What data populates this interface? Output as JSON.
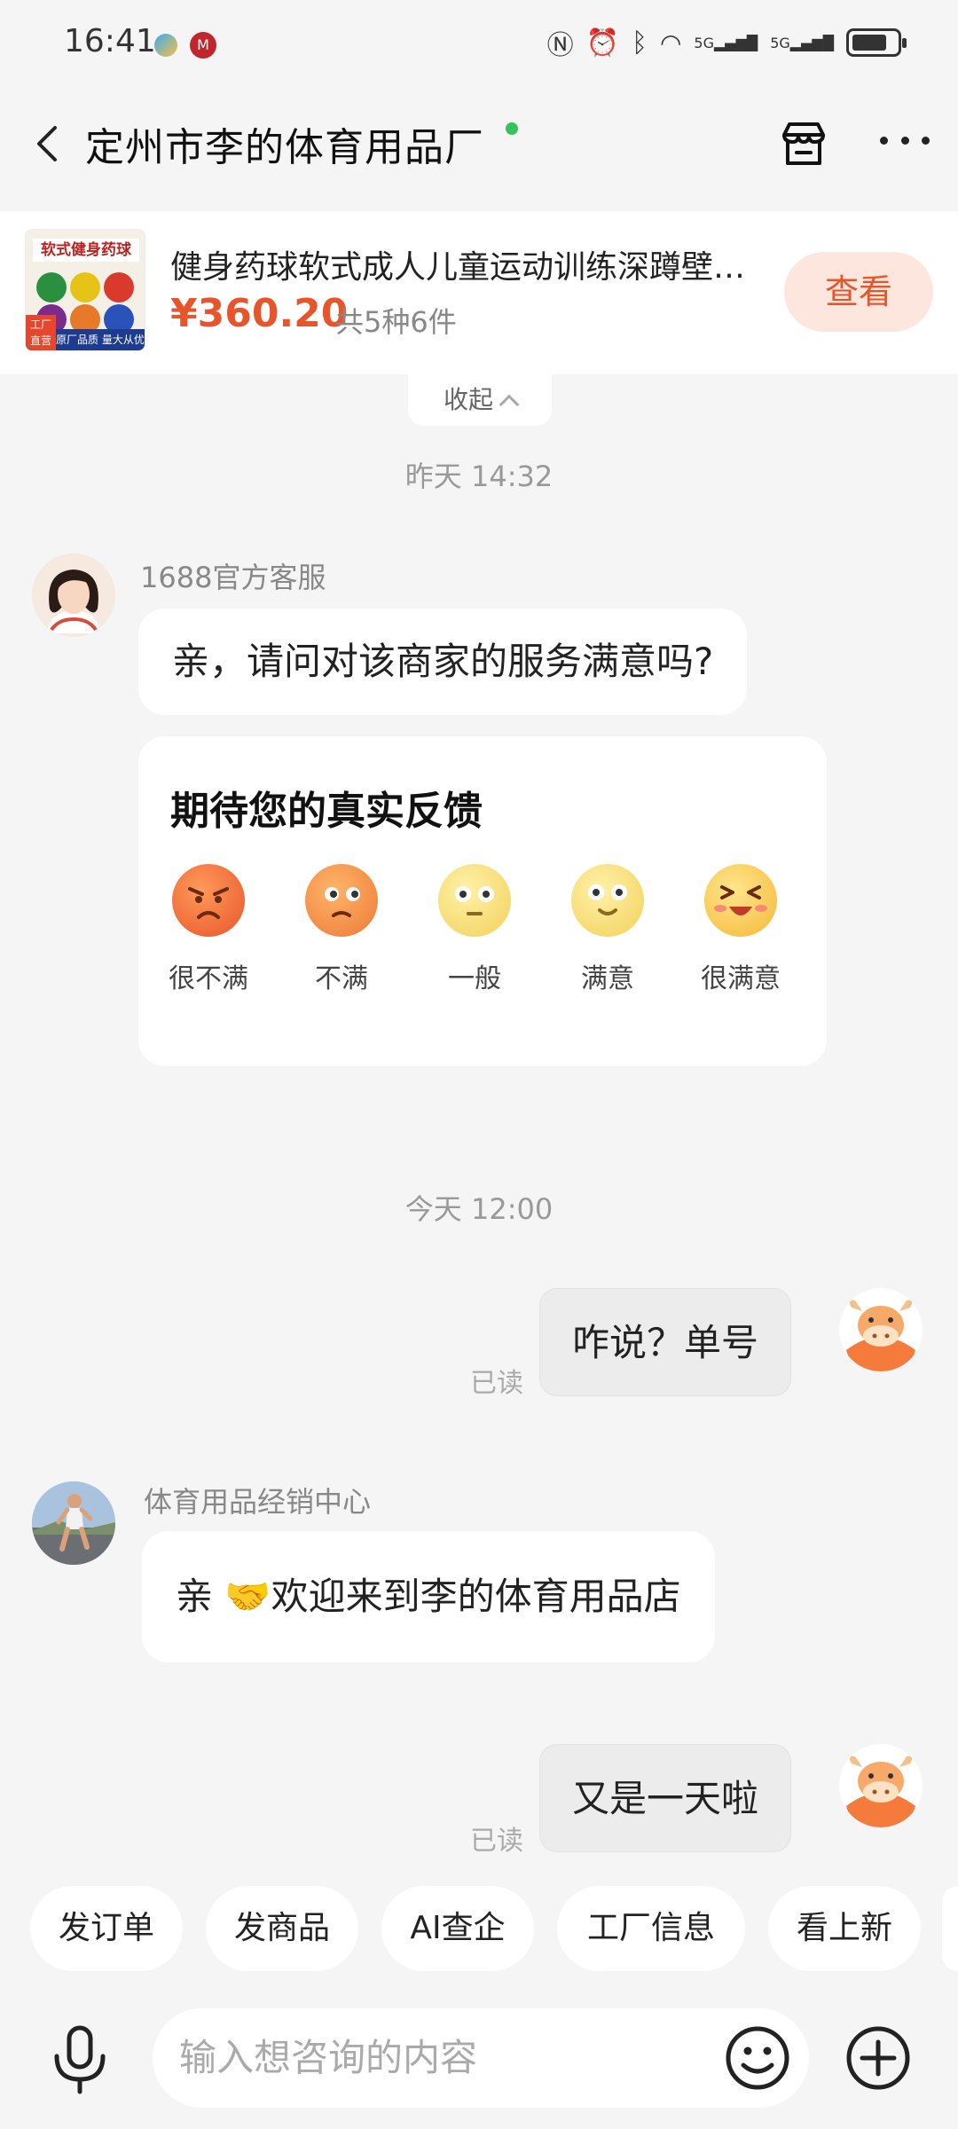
{
  "status_bar": {
    "time": "16:41",
    "network_1": "5G",
    "network_2": "5G"
  },
  "header": {
    "shop_name": "定州市李的体育用品厂",
    "back": "back-icon",
    "store": "store-icon",
    "more": "more-icon"
  },
  "product": {
    "name": "健身药球软式成人儿童运动训练深蹲壁球...",
    "price": "¥360.20",
    "qty": "共5种6件",
    "view_label": "查看",
    "image_banner": "软式健身药球",
    "image_tag": "工厂直营",
    "image_footer": "原厂品质 量大从优"
  },
  "collapse_label": "收起",
  "messages": {
    "ts_yesterday": "昨天  14:32",
    "service_name": "1688官方客服",
    "service_text": "亲，请问对该商家的服务满意吗?",
    "feedback_title": "期待您的真实反馈",
    "ratings": [
      "很不满",
      "不满",
      "一般",
      "满意",
      "很满意"
    ],
    "ts_today": "今天  12:00",
    "me_1": "咋说？单号",
    "read_1": "已读",
    "seller_name": "体育用品经销中心",
    "seller_text": "亲 🤝欢迎来到李的体育用品店",
    "me_2": "又是一天啦",
    "read_2": "已读"
  },
  "quick_actions": [
    "发订单",
    "发商品",
    "AI查企",
    "工厂信息",
    "看上新"
  ],
  "input": {
    "placeholder": "输入想咨询的内容"
  },
  "colors": {
    "accent": "#e8552a",
    "accent_bg": "#fde6dd",
    "online": "#36c25a",
    "bg": "#f5f5f5"
  }
}
